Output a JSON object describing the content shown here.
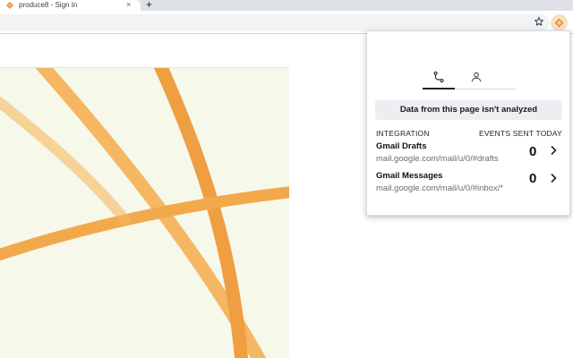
{
  "browser": {
    "tab_title": "produce8 - Sign In",
    "tab_close": "×",
    "new_tab": "+"
  },
  "popup": {
    "tabs": [
      {
        "icon": "flow-icon",
        "active": true
      },
      {
        "icon": "user-icon",
        "active": false
      }
    ],
    "notice": "Data from this page isn't analyzed",
    "columns": {
      "integration": "INTEGRATION",
      "events": "EVENTS SENT TODAY"
    },
    "integrations": [
      {
        "name": "Gmail Drafts",
        "url": "mail.google.com/mail/u/0/#drafts",
        "count": "0"
      },
      {
        "name": "Gmail Messages",
        "url": "mail.google.com/mail/u/0/#inbox/*",
        "count": "0"
      }
    ]
  },
  "colors": {
    "accent": "#f08a24",
    "art_background": "#f6f8ea",
    "stroke_orange": "#ef9a3a",
    "stroke_light": "#f5b45a"
  }
}
